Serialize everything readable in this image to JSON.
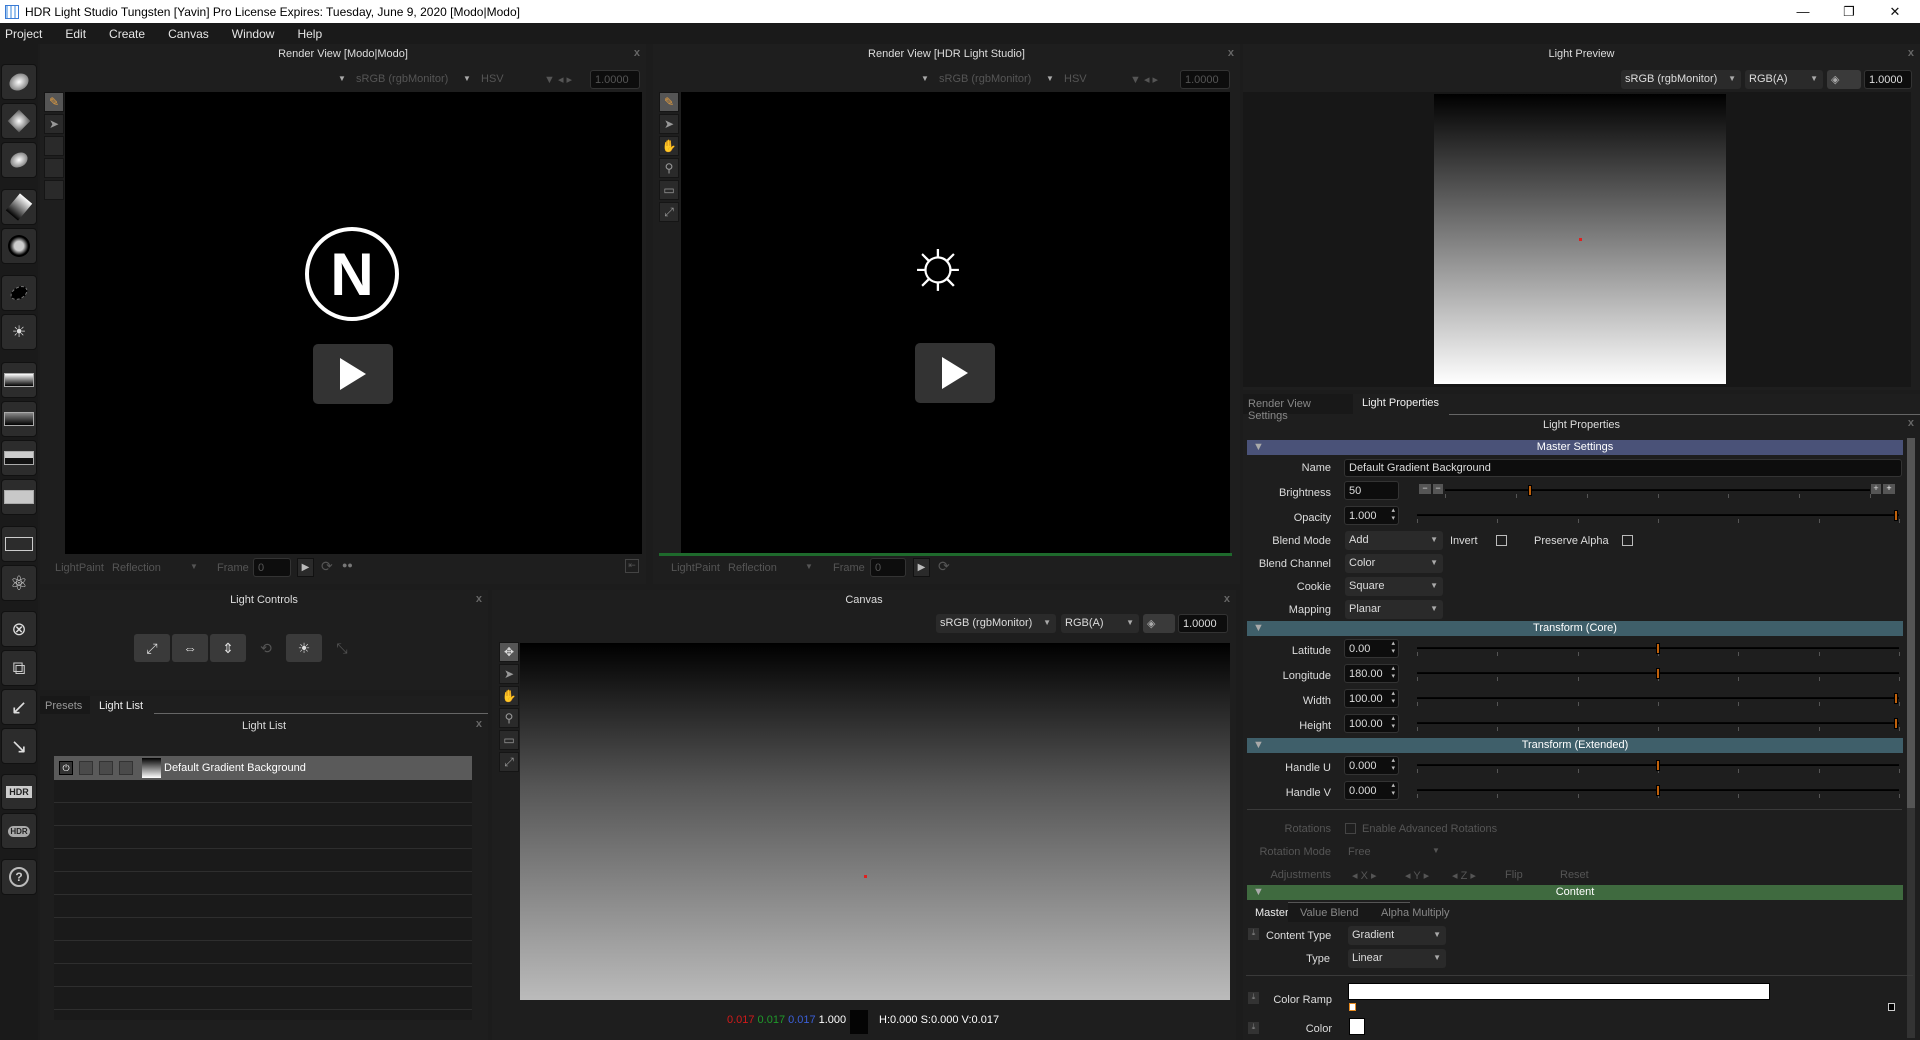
{
  "window": {
    "title": "HDR Light Studio Tungsten [Yavin] Pro License Expires: Tuesday, June 9, 2020  [Modo|Modo]",
    "controls": {
      "minimize": "—",
      "restore": "❐",
      "close": "✕"
    }
  },
  "menu": [
    "Project",
    "Edit",
    "Create",
    "Canvas",
    "Window",
    "Help"
  ],
  "left_toolbar": {
    "tools": [
      {
        "name": "add-light-reflection",
        "icon": "soft-spot-arrow-icon"
      },
      {
        "name": "add-light-rect",
        "icon": "diamond-spot-arrow-icon"
      },
      {
        "name": "add-light-spot",
        "icon": "oval-spot-arrow-icon"
      },
      {
        "name": "add-gradient-light",
        "icon": "gradient-square-arrow-icon"
      },
      {
        "name": "add-cookie-light",
        "icon": "cookie-arrow-icon"
      },
      {
        "name": "add-shadow",
        "icon": "shadow-arrow-icon"
      },
      {
        "name": "add-sun",
        "icon": "sun-frame-icon"
      },
      {
        "name": "gradient-background",
        "icon": "gradient-bg-icon"
      },
      {
        "name": "hdr-image-background",
        "icon": "hdr-image-icon"
      },
      {
        "name": "sky-background",
        "icon": "sky-bg-icon"
      },
      {
        "name": "flat-background",
        "icon": "flat-bg-icon"
      },
      {
        "name": "light-groups",
        "icon": "group-icon"
      },
      {
        "name": "light-atom",
        "icon": "atom-icon"
      },
      {
        "name": "delete-light",
        "icon": "close-circle-icon"
      },
      {
        "name": "duplicate-light",
        "icon": "duplicate-icon"
      },
      {
        "name": "undo",
        "icon": "undo-icon"
      },
      {
        "name": "redo",
        "icon": "redo-icon"
      },
      {
        "name": "render-hdr",
        "icon": "hdr-icon",
        "label": "HDR"
      },
      {
        "name": "refresh-hdr",
        "icon": "hdr-refresh-icon",
        "label": "HDR"
      },
      {
        "name": "help",
        "icon": "help-icon",
        "label": "?"
      }
    ]
  },
  "render_view_modo": {
    "title": "Render View [Modo|Modo]",
    "colorspace": "sRGB (rgbMonitor)",
    "channel": "HSV",
    "exposure": "1.0000",
    "lightpaint_label": "LightPaint",
    "lightpaint_mode": "Reflection",
    "frame_label": "Frame",
    "frame_value": "0"
  },
  "render_view_hdrls": {
    "title": "Render View [HDR Light Studio]",
    "colorspace": "sRGB (rgbMonitor)",
    "channel": "HSV",
    "exposure": "1.0000",
    "lightpaint_label": "LightPaint",
    "lightpaint_mode": "Reflection",
    "frame_label": "Frame",
    "frame_value": "0"
  },
  "light_preview": {
    "title": "Light Preview",
    "colorspace": "sRGB (rgbMonitor)",
    "channel": "RGB(A)",
    "exposure": "1.0000"
  },
  "light_controls": {
    "title": "Light Controls",
    "buttons": [
      "scale-icon",
      "width-icon",
      "height-icon",
      "rotate-icon",
      "brightness-icon",
      "spread-icon"
    ]
  },
  "left_tabs": {
    "tabs": [
      "Presets",
      "Light List"
    ],
    "active": "Light List"
  },
  "light_list": {
    "title": "Light List",
    "items": [
      {
        "name": "Default Gradient Background"
      }
    ],
    "empty_rows": 9
  },
  "canvas": {
    "title": "Canvas",
    "colorspace": "sRGB (rgbMonitor)",
    "channel": "RGB(A)",
    "exposure": "1.0000",
    "pixel_readout": {
      "r": "0.017",
      "g": "0.017",
      "b": "0.017",
      "a": "1.000",
      "hsv": "H:0.000 S:0.000 V:0.017"
    },
    "colors": {
      "r": "#d21a1a",
      "g": "#1f9a2a",
      "b": "#3b5fd8"
    }
  },
  "right_tabs": {
    "tabs": [
      "Render View Settings",
      "Light Properties"
    ],
    "active": "Light Properties"
  },
  "light_properties": {
    "title": "Light Properties",
    "sections": {
      "master": "Master Settings",
      "transform_core": "Transform (Core)",
      "transform_ext": "Transform (Extended)",
      "content": "Content"
    },
    "section_colors": {
      "master": "#4a5278",
      "transform": "#3f5f6a",
      "content": "#3f6a3f"
    },
    "name_label": "Name",
    "name_value": "Default Gradient Background",
    "brightness_label": "Brightness",
    "brightness_value": "50",
    "brightness_fraction": 0.2,
    "opacity_label": "Opacity",
    "opacity_value": "1.000",
    "opacity_fraction": 1.0,
    "blend_mode_label": "Blend Mode",
    "blend_mode_value": "Add",
    "invert_label": "Invert",
    "preserve_alpha_label": "Preserve Alpha",
    "blend_channel_label": "Blend Channel",
    "blend_channel_value": "Color",
    "cookie_label": "Cookie",
    "cookie_value": "Square",
    "mapping_label": "Mapping",
    "mapping_value": "Planar",
    "latitude_label": "Latitude",
    "latitude_value": "0.00",
    "latitude_fraction": 0.5,
    "longitude_label": "Longitude",
    "longitude_value": "180.00",
    "longitude_fraction": 0.5,
    "width_label": "Width",
    "width_value": "100.00",
    "width_fraction": 1.0,
    "height_label": "Height",
    "height_value": "100.00",
    "height_fraction": 1.0,
    "handle_u_label": "Handle U",
    "handle_u_value": "0.000",
    "handle_u_fraction": 0.5,
    "handle_v_label": "Handle V",
    "handle_v_value": "0.000",
    "handle_v_fraction": 0.5,
    "rotations_label": "Rotations",
    "enable_adv_rot_label": "Enable Advanced Rotations",
    "rotation_mode_label": "Rotation Mode",
    "rotation_mode_value": "Free",
    "adjustments_label": "Adjustments",
    "adj_x": "X",
    "adj_y": "Y",
    "adj_z": "Z",
    "flip_label": "Flip",
    "reset_label": "Reset",
    "content_tabs": [
      "Master",
      "Value Blend",
      "Alpha Multiply"
    ],
    "content_type_label": "Content Type",
    "content_type_value": "Gradient",
    "type_label": "Type",
    "type_value": "Linear",
    "color_ramp_label": "Color Ramp",
    "color_label": "Color"
  }
}
